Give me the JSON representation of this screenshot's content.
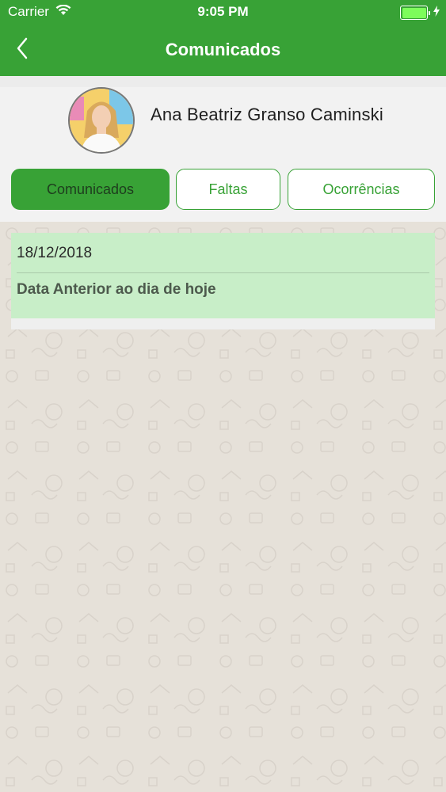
{
  "status_bar": {
    "carrier": "Carrier",
    "time": "9:05 PM",
    "wifi_icon": "wifi-icon",
    "battery_icon": "battery-charging-icon"
  },
  "nav": {
    "title": "Comunicados",
    "back_icon": "chevron-left-icon"
  },
  "profile": {
    "name": "Ana Beatriz Granso Caminski",
    "avatar": "student-photo"
  },
  "tabs": [
    {
      "label": "Comunicados",
      "active": true
    },
    {
      "label": "Faltas",
      "active": false
    },
    {
      "label": "Ocorrências",
      "active": false
    }
  ],
  "messages": [
    {
      "date": "18/12/2018",
      "text": "Data Anterior ao dia de hoje"
    }
  ],
  "colors": {
    "primary_green": "#38a236",
    "card_green": "#c8eec8",
    "background": "#e6e1d9"
  }
}
